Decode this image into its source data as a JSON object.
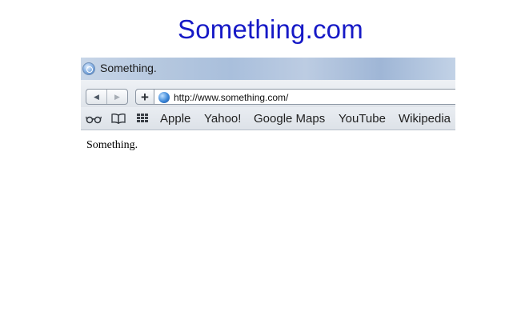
{
  "heading": "Something.com",
  "browser": {
    "window_title": "Something.",
    "address": {
      "url": "http://www.something.com/"
    },
    "toolbar": {
      "back_icon": "back-arrow-icon",
      "forward_icon": "forward-arrow-icon",
      "add_icon": "plus-icon",
      "add_label": "+"
    },
    "bookmarks": {
      "icons": [
        "reading-list-glasses-icon",
        "bookmarks-book-icon",
        "top-sites-grid-icon"
      ],
      "items": [
        "Apple",
        "Yahoo!",
        "Google Maps",
        "YouTube",
        "Wikipedia"
      ]
    },
    "page_content": {
      "text": "Something."
    }
  },
  "colors": {
    "heading": "#1619c6",
    "titlebar": "#b6c8df"
  }
}
